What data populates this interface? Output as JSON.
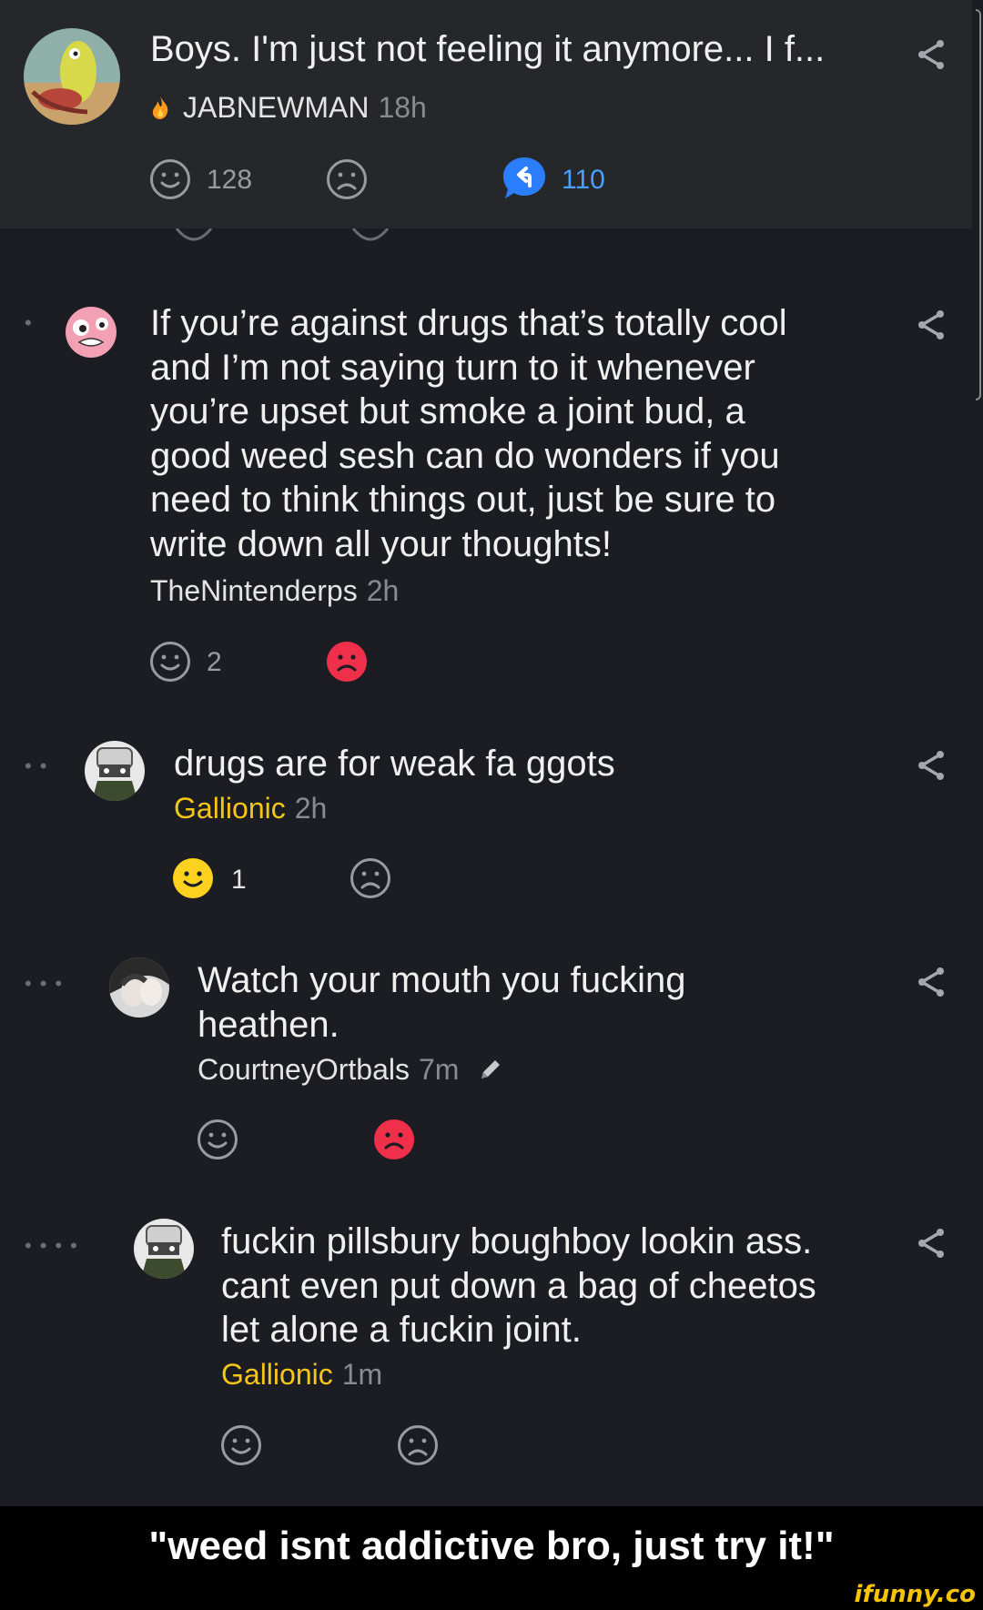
{
  "post": {
    "title": "Boys. I'm just not feeling it anymore... I f...",
    "author": "JABNEWMAN",
    "time": "18h",
    "smile_count": "128",
    "reply_count": "110"
  },
  "comments": [
    {
      "author": "TheNintenderps",
      "time": "2h",
      "text": "If you’re against drugs that’s totally cool and I’m not saying turn to it whenever you’re upset but smoke a joint bud, a good weed sesh can do wonders if you need to think things out, just be sure to write down all your thoughts!",
      "lines": [
        "If you’re against drugs that’s totally cool",
        "and I’m not saying turn to it whenever",
        "you’re upset but smoke a joint bud, a",
        "good weed sesh can do wonders if you",
        "need to think things out, just be sure to",
        "write down all your thoughts!"
      ],
      "smile_count": "2"
    },
    {
      "author": "Gallionic",
      "time": "2h",
      "lines": [
        "drugs are for weak fa ggots"
      ],
      "smile_count": "1"
    },
    {
      "author": "CourtneyOrtbals",
      "time": "7m",
      "lines": [
        "Watch your mouth you fucking",
        "heathen."
      ]
    },
    {
      "author": "Gallionic",
      "time": "1m",
      "lines": [
        "fuckin pillsbury boughboy lookin ass.",
        "cant even put down a bag of cheetos",
        "let alone a fuckin joint."
      ]
    }
  ],
  "caption": "\"weed isnt addictive bro, just try it!\"",
  "watermark": "ifunny.co",
  "colors": {
    "background": "#1c1d22",
    "header": "#26272b",
    "reply_blue": "#2b7fff",
    "smile_active": "#ffd21f",
    "frown_active": "#f0304a",
    "gold_author": "#f5c518",
    "muted": "#8a8b90"
  },
  "icons": [
    "fire-icon",
    "smile-icon",
    "frown-icon",
    "reply-icon",
    "share-icon",
    "edit-pencil-icon"
  ]
}
